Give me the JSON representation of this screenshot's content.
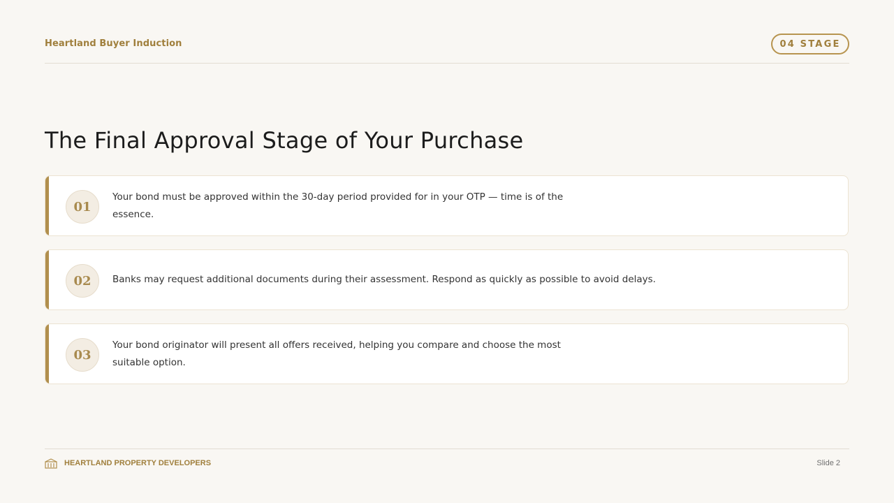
{
  "header": {
    "brand": "Heartland Buyer Induction",
    "stage_badge": "04 STAGE"
  },
  "title": "The Final Approval Stage of Your Purchase",
  "items": [
    {
      "number": "01",
      "text": "Your bond must be approved within the 30-day period provided for in your OTP — time is of the essence."
    },
    {
      "number": "02",
      "text": "Banks may request additional documents during their assessment. Respond as quickly as possible to avoid delays."
    },
    {
      "number": "03",
      "text": "Your bond originator will present all offers received, helping you compare and choose the most suitable option."
    }
  ],
  "footer": {
    "logo_icon": "building-icon",
    "brand": "HEARTLAND PROPERTY DEVELOPERS",
    "slide_label": "Slide 2"
  },
  "colors": {
    "accent": "#b18f4d",
    "brand_text": "#a07f3c",
    "background": "#f9f7f3"
  }
}
